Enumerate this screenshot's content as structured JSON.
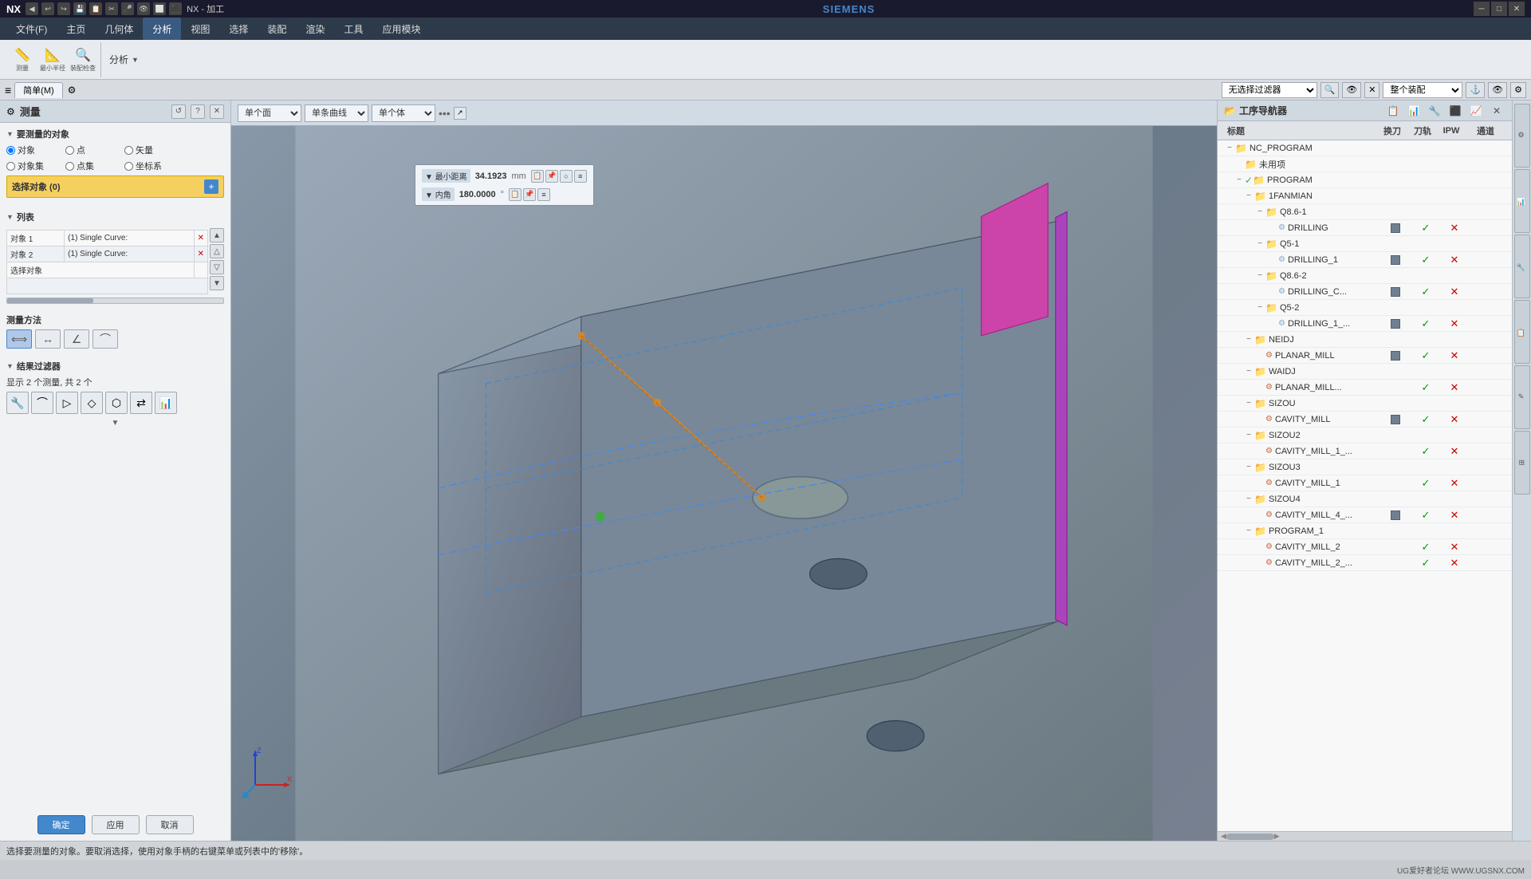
{
  "app": {
    "title": "NX - 加工",
    "brand": "SIEMENS",
    "logo": "NX"
  },
  "title_bar": {
    "title": "NX - 加工",
    "brand": "SIEMENS",
    "buttons": {
      "minimize": "─",
      "restore": "□",
      "close": "✕"
    }
  },
  "menu": {
    "items": [
      "文件(F)",
      "主页",
      "几何体",
      "分析",
      "视图",
      "选择",
      "装配",
      "渲染",
      "工具",
      "应用模块"
    ]
  },
  "toolbar": {
    "measure_label": "测量",
    "analysis_label": "分析"
  },
  "toolbar2": {
    "filter_label": "无选择过滤器",
    "assembly_label": "整个装配"
  },
  "left_panel": {
    "title": "测量",
    "section_objects": "要测量的对象",
    "radio_options": [
      "对象",
      "点",
      "矢量",
      "对象集",
      "点集",
      "坐标系"
    ],
    "selection_label": "选择对象 (0)",
    "section_list": "列表",
    "list_items": [
      {
        "col1": "对象 1",
        "col2": "(1) Single Curve:"
      },
      {
        "col1": "对象 2",
        "col2": "(1) Single Curve:"
      },
      {
        "col1": "选择对象",
        "col2": ""
      }
    ],
    "measure_method_label": "测量方法",
    "section_results": "结果过滤器",
    "results_label": "显示 2 个测量, 共 2 个",
    "buttons": {
      "confirm": "确定",
      "apply": "应用",
      "cancel": "取消"
    }
  },
  "viewport": {
    "toolbar": {
      "view_select": "单个面",
      "curve_select": "单条曲线",
      "body_select": "单个体"
    },
    "measurement": {
      "min_dist_label": "最小距离",
      "min_dist_value": "34.1923",
      "min_dist_unit": "mm",
      "angle_label": "内角",
      "angle_value": "180.0000",
      "angle_unit": "°"
    }
  },
  "right_panel": {
    "title": "工序导航器",
    "columns": {
      "label": "标题",
      "tool": "换刀",
      "check": "刀轨",
      "x": "IPW",
      "channel": "通道"
    },
    "tree": [
      {
        "level": 0,
        "expand": "−",
        "icon": "📁",
        "label": "NC_PROGRAM",
        "type": "folder"
      },
      {
        "level": 1,
        "expand": " ",
        "icon": "📁",
        "label": "未用项",
        "type": "folder"
      },
      {
        "level": 1,
        "expand": "−",
        "icon": "📁",
        "label": "PROGRAM",
        "type": "program"
      },
      {
        "level": 2,
        "expand": "−",
        "icon": "📁",
        "label": "1FANMIAN",
        "type": "folder"
      },
      {
        "level": 3,
        "expand": "−",
        "icon": "📁",
        "label": "Q8.6-1",
        "type": "folder"
      },
      {
        "level": 4,
        "expand": " ",
        "icon": "⚙",
        "label": "DRILLING",
        "type": "op",
        "tool": true,
        "check": true,
        "x": true
      },
      {
        "level": 3,
        "expand": "−",
        "icon": "📁",
        "label": "Q5-1",
        "type": "folder"
      },
      {
        "level": 4,
        "expand": " ",
        "icon": "⚙",
        "label": "DRILLING_1",
        "type": "op",
        "tool": true,
        "check": true,
        "x": true
      },
      {
        "level": 3,
        "expand": "−",
        "icon": "📁",
        "label": "Q8.6-2",
        "type": "folder"
      },
      {
        "level": 4,
        "expand": " ",
        "icon": "⚙",
        "label": "DRILLING_C...",
        "type": "op",
        "tool": true,
        "check": true,
        "x": true
      },
      {
        "level": 3,
        "expand": "−",
        "icon": "📁",
        "label": "Q5-2",
        "type": "folder"
      },
      {
        "level": 4,
        "expand": " ",
        "icon": "⚙",
        "label": "DRILLING_1_...",
        "type": "op",
        "tool": true,
        "check": true,
        "x": true
      },
      {
        "level": 2,
        "expand": "−",
        "icon": "📁",
        "label": "NEIDJ",
        "type": "folder"
      },
      {
        "level": 3,
        "expand": " ",
        "icon": "⚙",
        "label": "PLANAR_MILL",
        "type": "op",
        "tool": true,
        "check": true,
        "x": true
      },
      {
        "level": 2,
        "expand": "−",
        "icon": "📁",
        "label": "WAIDJ",
        "type": "folder"
      },
      {
        "level": 3,
        "expand": " ",
        "icon": "⚙",
        "label": "PLANAR_MILL...",
        "type": "op",
        "check": true,
        "x": true
      },
      {
        "level": 2,
        "expand": "−",
        "icon": "📁",
        "label": "SIZOU",
        "type": "folder"
      },
      {
        "level": 3,
        "expand": " ",
        "icon": "⚙",
        "label": "CAVITY_MILL",
        "type": "op",
        "tool": true,
        "check": true,
        "x": true
      },
      {
        "level": 2,
        "expand": "−",
        "icon": "📁",
        "label": "SIZOU2",
        "type": "folder"
      },
      {
        "level": 3,
        "expand": " ",
        "icon": "⚙",
        "label": "CAVITY_MILL_1_...",
        "type": "op",
        "check": true,
        "x": true
      },
      {
        "level": 2,
        "expand": "−",
        "icon": "📁",
        "label": "SIZOU3",
        "type": "folder"
      },
      {
        "level": 3,
        "expand": " ",
        "icon": "⚙",
        "label": "CAVITY_MILL_1",
        "type": "op",
        "check": true,
        "x": true
      },
      {
        "level": 2,
        "expand": "−",
        "icon": "📁",
        "label": "SIZOU4",
        "type": "folder"
      },
      {
        "level": 3,
        "expand": " ",
        "icon": "⚙",
        "label": "CAVITY_MILL_4_...",
        "type": "op",
        "tool": true,
        "check": true,
        "x": true
      },
      {
        "level": 2,
        "expand": "−",
        "icon": "📁",
        "label": "PROGRAM_1",
        "type": "folder"
      },
      {
        "level": 3,
        "expand": " ",
        "icon": "⚙",
        "label": "CAVITY_MILL_2",
        "type": "op",
        "check": true,
        "x": true
      },
      {
        "level": 3,
        "expand": " ",
        "icon": "⚙",
        "label": "CAVITY_MILL_2_...",
        "type": "op",
        "check": true,
        "x": true
      }
    ]
  },
  "status_bar": {
    "message": "选择要测量的对象。要取消选择，使用对象手柄的右键菜单或列表中的'移除'。"
  },
  "bottom_bar": {
    "text": "UG爱好者论坛 WWW.UGSNX.COM"
  },
  "second_toolbar": {
    "tab_label": "简单(M)",
    "icons": [
      "≡",
      "⚙"
    ]
  }
}
